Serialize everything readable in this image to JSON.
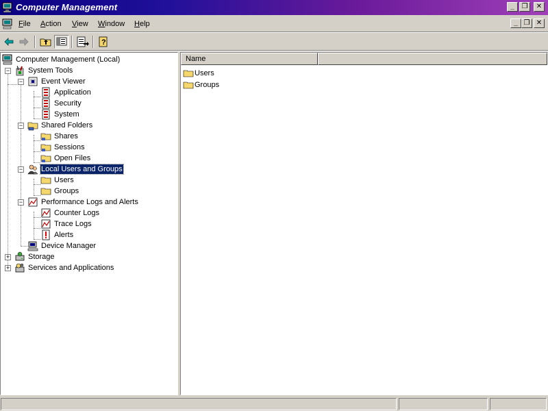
{
  "window": {
    "title": "Computer Management",
    "controls": {
      "minimize": "_",
      "restore": "❐",
      "close": "✕"
    }
  },
  "menu": {
    "items": [
      {
        "label": "File",
        "accel": "F",
        "rest": "ile"
      },
      {
        "label": "Action",
        "accel": "A",
        "rest": "ction"
      },
      {
        "label": "View",
        "accel": "V",
        "rest": "iew"
      },
      {
        "label": "Window",
        "accel": "W",
        "rest": "indow"
      },
      {
        "label": "Help",
        "accel": "H",
        "rest": "elp"
      }
    ]
  },
  "tree": {
    "root": "Computer Management (Local)",
    "system_tools": "System Tools",
    "event_viewer": "Event Viewer",
    "application": "Application",
    "security": "Security",
    "system": "System",
    "shared_folders": "Shared Folders",
    "shares": "Shares",
    "sessions": "Sessions",
    "open_files": "Open Files",
    "local_users_groups": "Local Users and Groups",
    "users": "Users",
    "groups": "Groups",
    "perf_logs": "Performance Logs and Alerts",
    "counter_logs": "Counter Logs",
    "trace_logs": "Trace Logs",
    "alerts": "Alerts",
    "device_manager": "Device Manager",
    "storage": "Storage",
    "services_apps": "Services and Applications",
    "expander_minus": "−",
    "expander_plus": "+"
  },
  "list": {
    "column_name": "Name",
    "items": [
      "Users",
      "Groups"
    ]
  },
  "colors": {
    "selection": "#0a246a",
    "folder": "#f5d76e",
    "title_start": "#0a0080",
    "title_end": "#a040b8"
  }
}
